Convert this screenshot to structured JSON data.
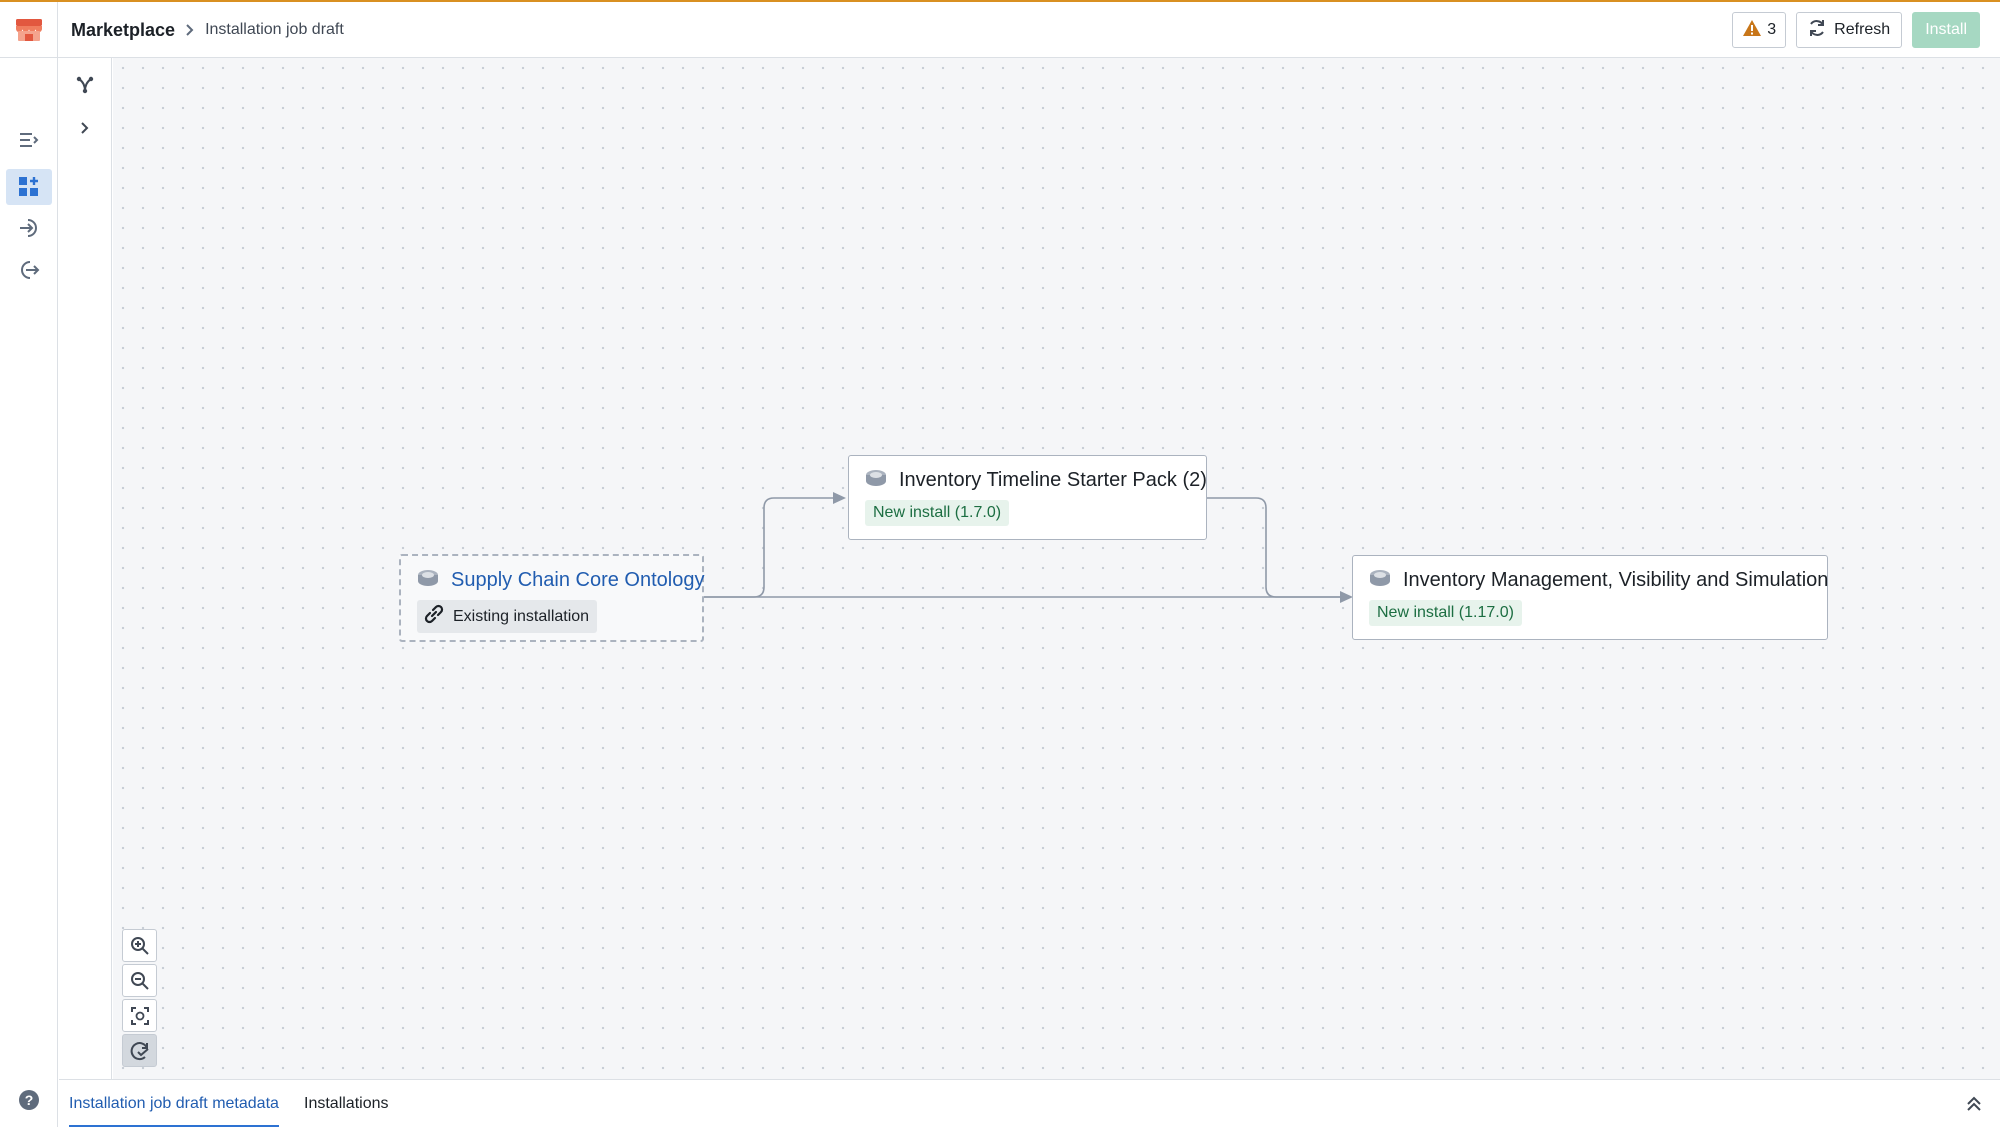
{
  "colors": {
    "accent_top": "#d99021",
    "link_blue": "#215db0",
    "green_tag_bg": "#e7f3ec",
    "green_tag_text": "#1c6e42",
    "install_button_bg": "#a6d8c2",
    "warning": "#c87619"
  },
  "header": {
    "app_icon": "marketplace-store-icon",
    "breadcrumb_root": "Marketplace",
    "breadcrumb_separator_icon": "chevron-right-icon",
    "breadcrumb_current": "Installation job draft",
    "warnings_count": "3",
    "warnings_icon": "warning-triangle-icon",
    "refresh_label": "Refresh",
    "refresh_icon": "refresh-icon",
    "install_label": "Install"
  },
  "left_rail": {
    "items": [
      {
        "icon": "list-expand-icon"
      },
      {
        "icon": "graph-grid-icon",
        "active": true
      },
      {
        "icon": "log-in-icon"
      },
      {
        "icon": "log-out-icon"
      }
    ],
    "help_icon": "help-circle-icon"
  },
  "secondary_rail": {
    "items": [
      {
        "icon": "graph-fork-icon"
      },
      {
        "icon": "chevron-right-icon"
      }
    ]
  },
  "graph": {
    "nodes": [
      {
        "title": "Supply Chain Core Ontology",
        "icon": "package-icon",
        "tag": "Existing installation",
        "tag_icon": "link-icon",
        "style": "existing"
      },
      {
        "title": "Inventory Timeline Starter Pack (2)",
        "icon": "package-icon",
        "tag": "New install (1.7.0)",
        "style": "new"
      },
      {
        "title": "Inventory Management, Visibility and Simulation",
        "icon": "package-icon",
        "tag": "New install (1.17.0)",
        "style": "new"
      }
    ]
  },
  "zoom_controls": [
    {
      "icon": "zoom-in-icon"
    },
    {
      "icon": "zoom-out-icon"
    },
    {
      "icon": "zoom-to-fit-icon"
    },
    {
      "icon": "auto-layout-icon",
      "active": true
    }
  ],
  "bottom_panel": {
    "tabs": [
      {
        "label": "Installation job draft metadata",
        "active": true
      },
      {
        "label": "Installations",
        "active": false
      }
    ],
    "collapse_icon": "chevrons-up-icon"
  }
}
